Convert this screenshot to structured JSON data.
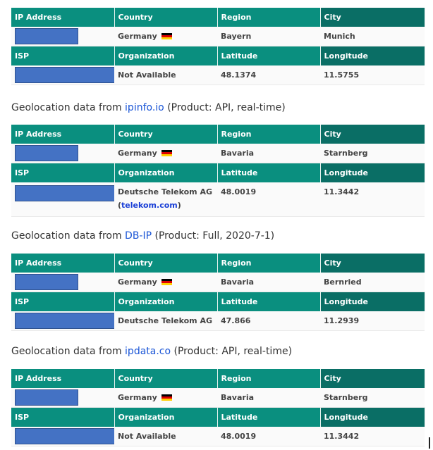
{
  "labels": {
    "ip_address": "IP Address",
    "country": "Country",
    "region": "Region",
    "city": "City",
    "isp": "ISP",
    "organization": "Organization",
    "latitude": "Latitude",
    "longitude": "Longitude"
  },
  "colors": {
    "header_light": "#0a8f7f",
    "header_dark": "#0a6e65",
    "link": "#1a55d6",
    "redaction": "#4472c4"
  },
  "sources": [
    {
      "caption": null,
      "country": "Germany",
      "region": "Bayern",
      "city": "Munich",
      "organization": "Not Available",
      "latitude": "48.1374",
      "longitude": "11.5755"
    },
    {
      "caption": {
        "prefix": "Geolocation data from ",
        "link": "ipinfo.io",
        "suffix": " (Product: API, real-time)"
      },
      "country": "Germany",
      "region": "Bavaria",
      "city": "Starnberg",
      "organization": "Deutsche Telekom AG",
      "org_domain": "telekom.com",
      "latitude": "48.0019",
      "longitude": "11.3442"
    },
    {
      "caption": {
        "prefix": "Geolocation data from ",
        "link": "DB-IP",
        "suffix": " (Product: Full, 2020-7-1)"
      },
      "country": "Germany",
      "region": "Bavaria",
      "city": "Bernried",
      "organization": "Deutsche Telekom AG",
      "latitude": "47.866",
      "longitude": "11.2939"
    },
    {
      "caption": {
        "prefix": "Geolocation data from ",
        "link": "ipdata.co",
        "suffix": " (Product: API, real-time)"
      },
      "country": "Germany",
      "region": "Bavaria",
      "city": "Starnberg",
      "organization": "Not Available",
      "latitude": "48.0019",
      "longitude": "11.3442"
    }
  ]
}
